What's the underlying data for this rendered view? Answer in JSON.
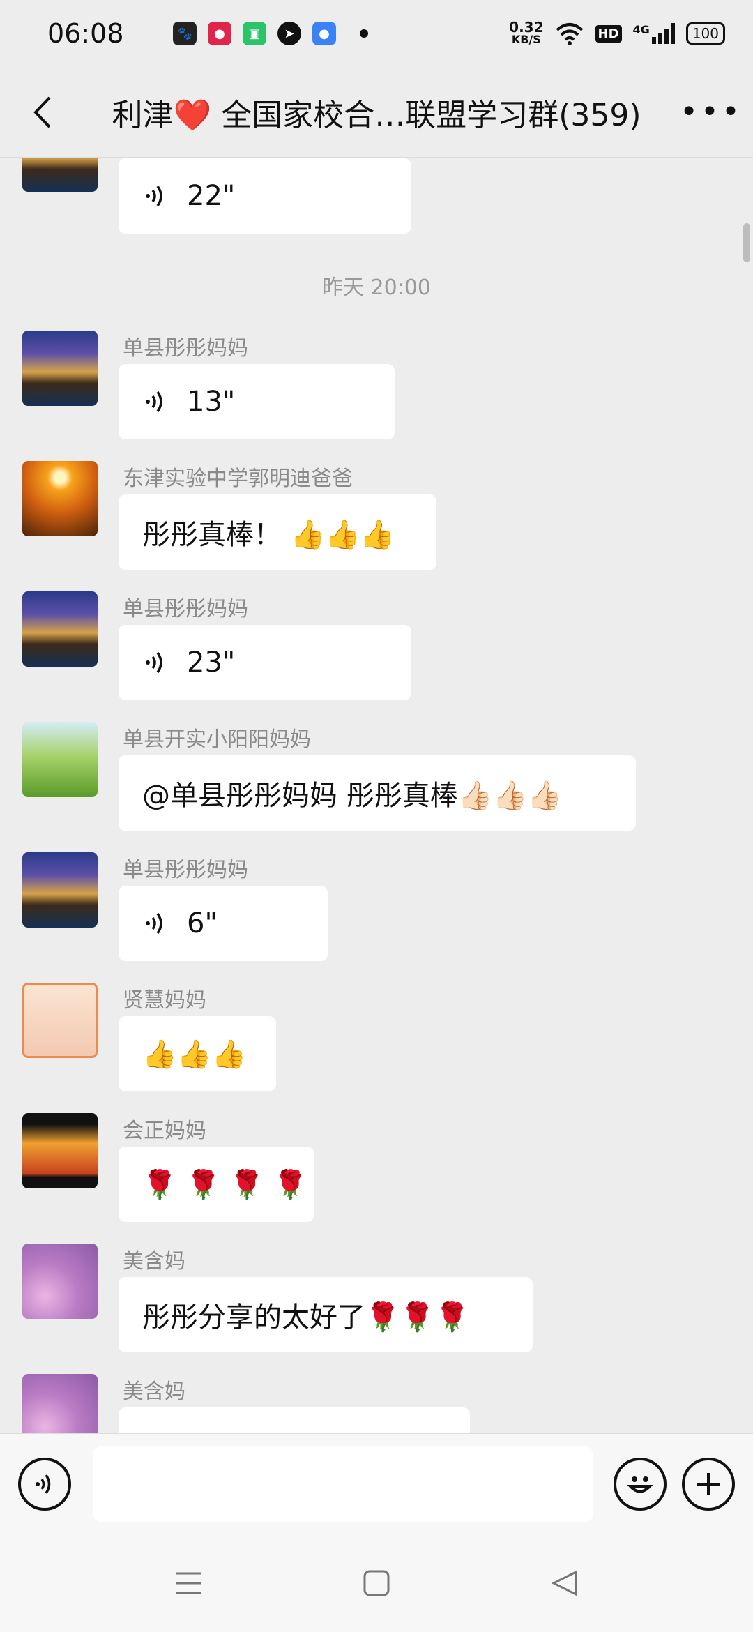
{
  "status_bar": {
    "time": "06:08",
    "speed_value": "0.32",
    "speed_unit": "KB/S",
    "network": "4G",
    "hd": "HD",
    "battery": "100"
  },
  "header": {
    "title": "利津❤️ 全国家校合…联盟学习群(359)"
  },
  "messages": [
    {
      "type": "voice",
      "sender": "",
      "duration": "22\""
    },
    {
      "type": "time",
      "text": "昨天 20:00"
    },
    {
      "type": "voice",
      "sender": "单县彤彤妈妈",
      "duration": "13\""
    },
    {
      "type": "text",
      "sender": "东津实验中学郭明迪爸爸",
      "text": "彤彤真棒！ 👍👍👍"
    },
    {
      "type": "voice",
      "sender": "单县彤彤妈妈",
      "duration": "23\""
    },
    {
      "type": "text",
      "sender": "单县开实小阳阳妈妈",
      "text": "@单县彤彤妈妈  彤彤真棒👍🏻👍🏻👍🏻"
    },
    {
      "type": "voice",
      "sender": "单县彤彤妈妈",
      "duration": "6\""
    },
    {
      "type": "text",
      "sender": "贤慧妈妈",
      "text": "👍👍👍"
    },
    {
      "type": "text",
      "sender": "会正妈妈",
      "text": "🌹 🌹 🌹 🌹"
    },
    {
      "type": "text",
      "sender": "美含妈",
      "text": "彤彤分享的太好了🌹🌹🌹"
    },
    {
      "type": "text",
      "sender": "美含妈",
      "text": "向彤彤妈妈好🙂🙂🙂"
    }
  ],
  "input": {
    "placeholder": ""
  }
}
